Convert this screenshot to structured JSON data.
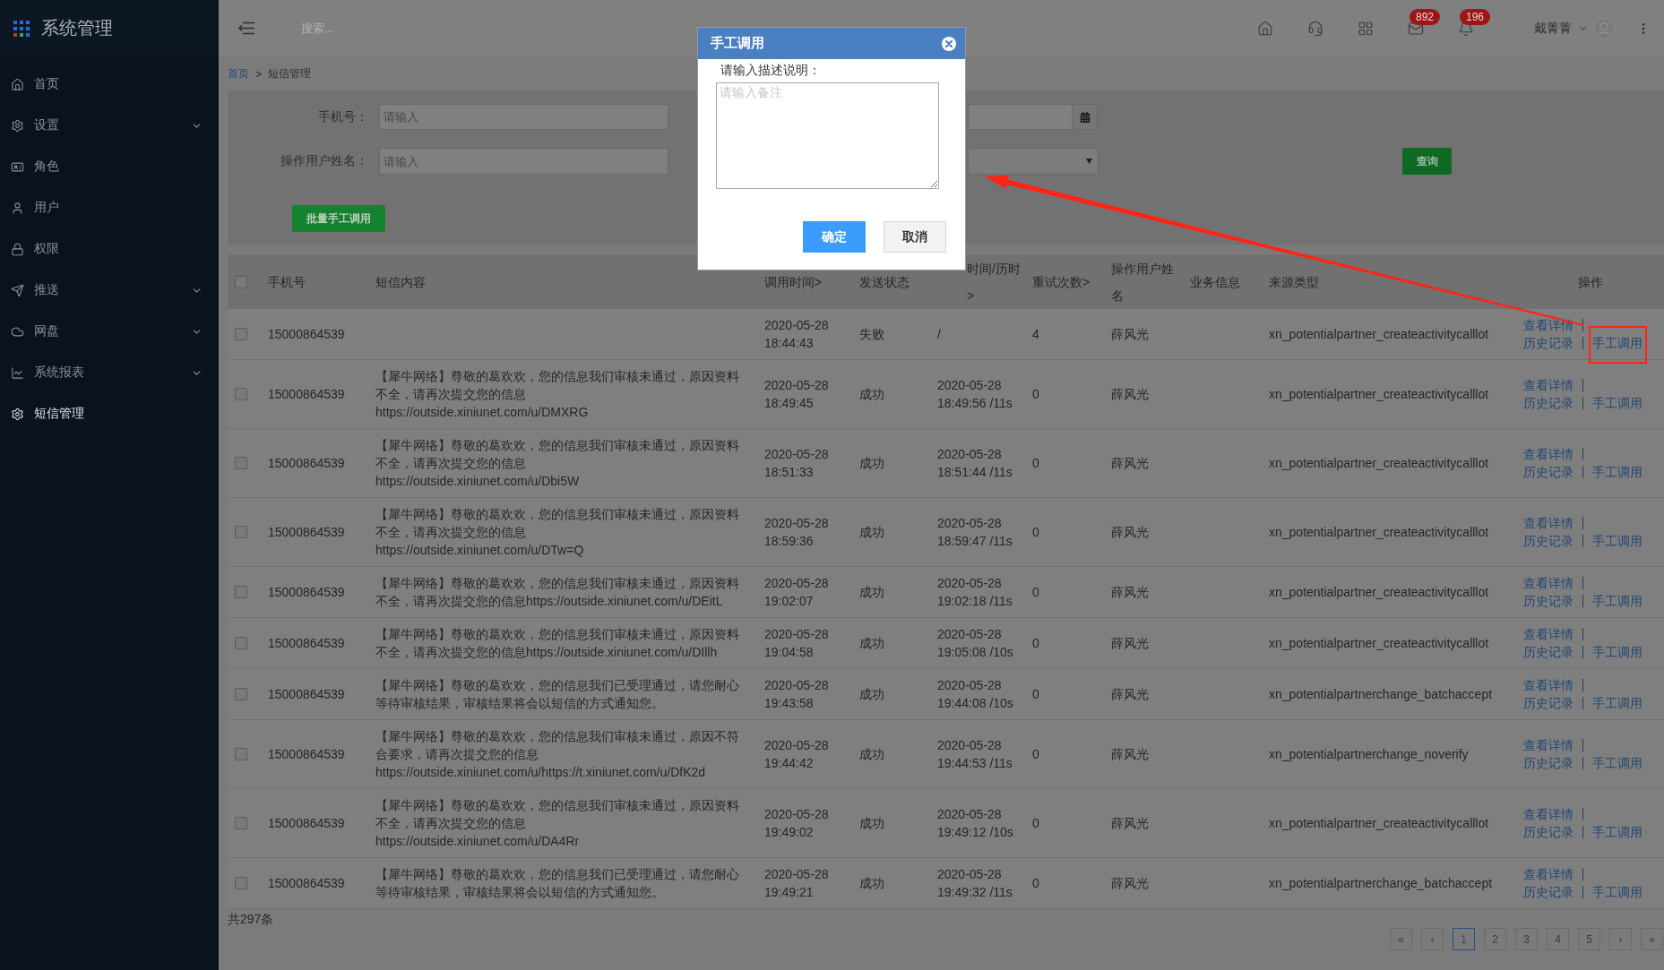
{
  "sidebar": {
    "title": "系统管理",
    "items": [
      {
        "label": "首页",
        "expandable": false,
        "selected": false
      },
      {
        "label": "设置",
        "expandable": true,
        "selected": false
      },
      {
        "label": "角色",
        "expandable": false,
        "selected": false
      },
      {
        "label": "用户",
        "expandable": false,
        "selected": false
      },
      {
        "label": "权限",
        "expandable": false,
        "selected": false
      },
      {
        "label": "推送",
        "expandable": true,
        "selected": false
      },
      {
        "label": "网盘",
        "expandable": true,
        "selected": false
      },
      {
        "label": "系统报表",
        "expandable": true,
        "selected": false
      },
      {
        "label": "短信管理",
        "expandable": false,
        "selected": true
      }
    ]
  },
  "header": {
    "search_placeholder": "搜索...",
    "icons": [
      {
        "kind": "home"
      },
      {
        "kind": "headset"
      },
      {
        "kind": "grid"
      },
      {
        "kind": "mail",
        "badge": "892"
      },
      {
        "kind": "bell",
        "badge": "196"
      }
    ],
    "user_name": "戴菁菁"
  },
  "breadcrumb": {
    "items": [
      {
        "label": "首页",
        "kind": "link"
      },
      {
        "label": "短信管理",
        "kind": "current"
      }
    ],
    "separator": ">"
  },
  "filters": {
    "fields": [
      {
        "label": "手机号：",
        "placeholder": "请输入"
      },
      {
        "label": "操作用户姓名：",
        "placeholder": "请输入"
      }
    ],
    "query_button": "查询",
    "batch_button": "批量手工调用"
  },
  "table": {
    "header_checked": false,
    "columns": [
      "手机号",
      "短信内容",
      "调用时间>",
      "发送状态",
      "时间/历时 >",
      "重试次数>",
      "操作用户姓名",
      "业务信息",
      "来源类型",
      "操作"
    ],
    "rows": [
      {
        "checked": false,
        "highlighted": true,
        "phone": "15000864539",
        "call_time": "2020-05-28 18:44:43",
        "status": "失败",
        "arrival": "/",
        "retries": "4",
        "operator": "薛风光",
        "source": "xn_potentialpartner_createactivitycalllot",
        "actions": [
          "查看详情",
          "历史记录",
          "手工调用"
        ]
      },
      {
        "checked": false,
        "highlighted": false,
        "phone": "15000864539",
        "content": "【犀牛网络】尊敬的葛欢欢，您的信息我们审核未通过，原因资料不全，请再次提交您的信息\nhttps://outside.xiniunet.com/u/DMXRG",
        "call_time": "2020-05-28 18:49:45",
        "status": "成功",
        "arrival": "2020-05-28 18:49:56 /11s",
        "retries": "0",
        "operator": "薛风光",
        "source": "xn_potentialpartner_createactivitycalllot",
        "actions": [
          "查看详情",
          "历史记录",
          "手工调用"
        ]
      },
      {
        "checked": false,
        "highlighted": false,
        "phone": "15000864539",
        "content": "【犀牛网络】尊敬的葛欢欢，您的信息我们审核未通过，原因资料不全，请再次提交您的信息\nhttps://outside.xiniunet.com/u/Dbi5W",
        "call_time": "2020-05-28 18:51:33",
        "status": "成功",
        "arrival": "2020-05-28 18:51:44 /11s",
        "retries": "0",
        "operator": "薛风光",
        "source": "xn_potentialpartner_createactivitycalllot",
        "actions": [
          "查看详情",
          "历史记录",
          "手工调用"
        ]
      },
      {
        "checked": false,
        "highlighted": false,
        "phone": "15000864539",
        "content": "【犀牛网络】尊敬的葛欢欢，您的信息我们审核未通过，原因资料不全，请再次提交您的信息\nhttps://outside.xiniunet.com/u/DTw=Q",
        "call_time": "2020-05-28 18:59:36",
        "status": "成功",
        "arrival": "2020-05-28 18:59:47 /11s",
        "retries": "0",
        "operator": "薛风光",
        "source": "xn_potentialpartner_createactivitycalllot",
        "actions": [
          "查看详情",
          "历史记录",
          "手工调用"
        ]
      },
      {
        "checked": false,
        "highlighted": false,
        "phone": "15000864539",
        "content": "【犀牛网络】尊敬的葛欢欢，您的信息我们审核未通过，原因资料不全，请再次提交您的信息https://outside.xiniunet.com/u/DEitL",
        "call_time": "2020-05-28 19:02:07",
        "status": "成功",
        "arrival": "2020-05-28 19:02:18 /11s",
        "retries": "0",
        "operator": "薛风光",
        "source": "xn_potentialpartner_createactivitycalllot",
        "actions": [
          "查看详情",
          "历史记录",
          "手工调用"
        ]
      },
      {
        "checked": false,
        "highlighted": false,
        "phone": "15000864539",
        "content": "【犀牛网络】尊敬的葛欢欢，您的信息我们审核未通过，原因资料不全，请再次提交您的信息https://outside.xiniunet.com/u/DIllh",
        "call_time": "2020-05-28 19:04:58",
        "status": "成功",
        "arrival": "2020-05-28 19:05:08 /10s",
        "retries": "0",
        "operator": "薛风光",
        "source": "xn_potentialpartner_createactivitycalllot",
        "actions": [
          "查看详情",
          "历史记录",
          "手工调用"
        ]
      },
      {
        "checked": false,
        "highlighted": false,
        "phone": "15000864539",
        "content": "【犀牛网络】尊敬的葛欢欢，您的信息我们已受理通过，请您耐心等待审核结果，审核结果将会以短信的方式通知您。",
        "call_time": "2020-05-28 19:43:58",
        "status": "成功",
        "arrival": "2020-05-28 19:44:08 /10s",
        "retries": "0",
        "operator": "薛风光",
        "source": "xn_potentialpartnerchange_batchaccept",
        "actions": [
          "查看详情",
          "历史记录",
          "手工调用"
        ]
      },
      {
        "checked": false,
        "highlighted": false,
        "phone": "15000864539",
        "content": "【犀牛网络】尊敬的葛欢欢，您的信息我们审核未通过，原因不符合要求，请再次提交您的信息\nhttps://outside.xiniunet.com/u/https://t.xiniunet.com/u/DfK2d",
        "call_time": "2020-05-28 19:44:42",
        "status": "成功",
        "arrival": "2020-05-28 19:44:53 /11s",
        "retries": "0",
        "operator": "薛风光",
        "source": "xn_potentialpartnerchange_noverify",
        "actions": [
          "查看详情",
          "历史记录",
          "手工调用"
        ]
      },
      {
        "checked": false,
        "highlighted": false,
        "phone": "15000864539",
        "content": "【犀牛网络】尊敬的葛欢欢，您的信息我们审核未通过，原因资料不全，请再次提交您的信息\nhttps://outside.xiniunet.com/u/DA4Rr",
        "call_time": "2020-05-28 19:49:02",
        "status": "成功",
        "arrival": "2020-05-28 19:49:12 /10s",
        "retries": "0",
        "operator": "薛风光",
        "source": "xn_potentialpartner_createactivitycalllot",
        "actions": [
          "查看详情",
          "历史记录",
          "手工调用"
        ]
      },
      {
        "checked": false,
        "highlighted": false,
        "phone": "15000864539",
        "content": "【犀牛网络】尊敬的葛欢欢，您的信息我们已受理通过，请您耐心等待审核结果，审核结果将会以短信的方式通知您。",
        "call_time": "2020-05-28 19:49:21",
        "status": "成功",
        "arrival": "2020-05-28 19:49:32 /11s",
        "retries": "0",
        "operator": "薛风光",
        "source": "xn_potentialpartnerchange_batchaccept",
        "actions": [
          "查看详情",
          "历史记录",
          "手工调用"
        ]
      }
    ]
  },
  "footer": {
    "total": "共297条"
  },
  "pagination": {
    "items": [
      {
        "label": "«",
        "selected": false
      },
      {
        "label": "‹",
        "selected": false
      },
      {
        "label": "1",
        "selected": true
      },
      {
        "label": "2",
        "selected": false
      },
      {
        "label": "3",
        "selected": false
      },
      {
        "label": "4",
        "selected": false
      },
      {
        "label": "5",
        "selected": false
      },
      {
        "label": "›",
        "selected": false
      },
      {
        "label": "»",
        "selected": false
      }
    ]
  },
  "dialog": {
    "title": "手工调用",
    "label": "请输入描述说明：",
    "placeholder": "请输入备注",
    "buttons": [
      {
        "label": "确定",
        "kind": "primary"
      },
      {
        "label": "取消",
        "kind": "default"
      }
    ]
  }
}
